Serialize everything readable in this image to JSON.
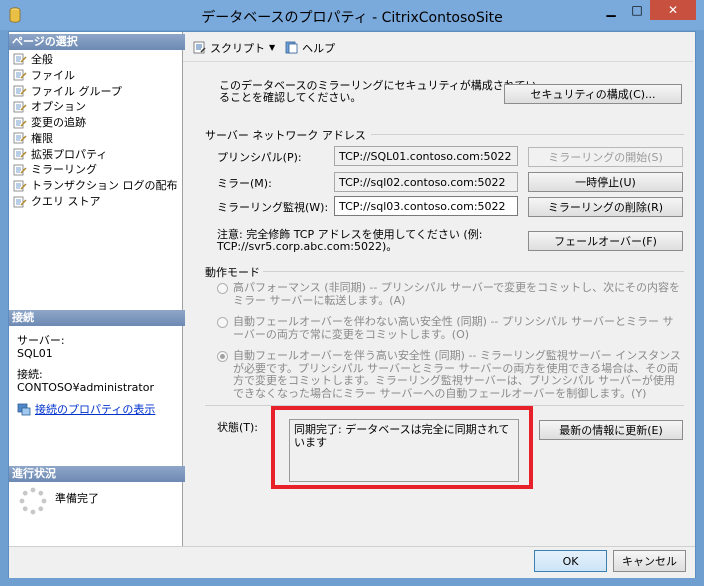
{
  "window": {
    "title": "データベースのプロパティ - CitrixContosoSite",
    "minimize": "▁",
    "maximize": "□",
    "close": "✕"
  },
  "left": {
    "pages_header": "ページの選択",
    "pages": [
      "全般",
      "ファイル",
      "ファイル グループ",
      "オプション",
      "変更の追跡",
      "権限",
      "拡張プロパティ",
      "ミラーリング",
      "トランザクション ログの配布",
      "クエリ ストア"
    ],
    "connection_header": "接続",
    "server_label": "サーバー:",
    "server_value": "SQL01",
    "connection_label": "接続:",
    "connection_value": "CONTOSO¥administrator",
    "view_connection_link": "接続のプロパティの表示",
    "progress_header": "進行状況",
    "progress_status": "準備完了"
  },
  "toolbar": {
    "script": "スクリプト",
    "help": "ヘルプ"
  },
  "mirroring": {
    "security_text_line1": "このデータベースのミラーリングにセキュリティが構成されてい",
    "security_text_line2": "ることを確認してください。",
    "configure_security_button": "セキュリティの構成(C)...",
    "network_group": "サーバー ネットワーク アドレス",
    "principal_label": "プリンシパル(P):",
    "principal_value": "TCP://SQL01.contoso.com:5022",
    "mirror_label": "ミラー(M):",
    "mirror_value": "TCP://sql02.contoso.com:5022",
    "witness_label": "ミラーリング監視(W):",
    "witness_value": "TCP://sql03.contoso.com:5022",
    "start_mirroring_button": "ミラーリングの開始(S)",
    "pause_button": "一時停止(U)",
    "remove_mirroring_button": "ミラーリングの削除(R)",
    "note_line1": "注意: 完全修飾 TCP アドレスを使用してください (例:",
    "note_line2": "TCP://svr5.corp.abc.com:5022)。",
    "failover_button": "フェールオーバー(F)",
    "mode_group": "動作モード",
    "mode_high_performance": "高パフォーマンス (非同期) -- プリンシパル サーバーで変更をコミットし、次にその内容をミラー サーバーに転送します。(A)",
    "mode_high_safety_no_failover": "自動フェールオーバーを伴わない高い安全性 (同期) -- プリンシパル サーバーとミラー サーバーの両方で常に変更をコミットします。(O)",
    "mode_high_safety_failover": "自動フェールオーバーを伴う高い安全性 (同期) -- ミラーリング監視サーバー インスタンスが必要です。プリンシパル サーバーとミラー サーバーの両方を使用できる場合は、その両方で変更をコミットします。ミラーリング監視サーバーは、プリンシパル サーバーが使用できなくなった場合にミラー サーバーへの自動フェールオーバーを制御します。(Y)",
    "status_label": "状態(T):",
    "status_value": "同期完了: データベースは完全に同期されています",
    "refresh_button": "最新の情報に更新(E)"
  },
  "footer": {
    "ok": "OK",
    "cancel": "キャンセル"
  }
}
